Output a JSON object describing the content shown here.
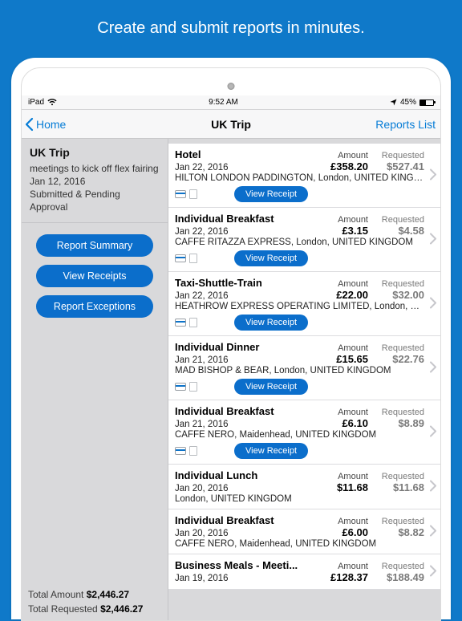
{
  "tagline": "Create and submit reports in minutes.",
  "status": {
    "device": "iPad",
    "time": "9:52 AM",
    "battery_pct": "45%"
  },
  "nav": {
    "back": "Home",
    "title": "UK Trip",
    "right": "Reports List"
  },
  "trip": {
    "name": "UK Trip",
    "desc": "meetings to kick off flex fairing",
    "date": "Jan 12, 2016",
    "status": "Submitted & Pending Approval"
  },
  "sidebar": {
    "summary_btn": "Report Summary",
    "receipts_btn": "View Receipts",
    "exceptions_btn": "Report Exceptions",
    "total_amount_label": "Total Amount",
    "total_amount": "$2,446.27",
    "total_requested_label": "Total Requested",
    "total_requested": "$2,446.27"
  },
  "labels": {
    "amount": "Amount",
    "requested": "Requested",
    "view_receipt": "View Receipt"
  },
  "expenses": [
    {
      "title": "Hotel",
      "date": "Jan 22, 2016",
      "amount": "£358.20",
      "requested": "$527.41",
      "vendor": "HILTON LONDON PADDINGTON, London, UNITED KINGD...",
      "receipt": true
    },
    {
      "title": "Individual Breakfast",
      "date": "Jan 22, 2016",
      "amount": "£3.15",
      "requested": "$4.58",
      "vendor": "CAFFE RITAZZA EXPRESS, London, UNITED KINGDOM",
      "receipt": true
    },
    {
      "title": "Taxi-Shuttle-Train",
      "date": "Jan 22, 2016",
      "amount": "£22.00",
      "requested": "$32.00",
      "vendor": "HEATHROW EXPRESS OPERATING LIMITED, London, UN...",
      "receipt": true
    },
    {
      "title": "Individual Dinner",
      "date": "Jan 21, 2016",
      "amount": "£15.65",
      "requested": "$22.76",
      "vendor": "MAD BISHOP & BEAR, London, UNITED KINGDOM",
      "receipt": true
    },
    {
      "title": "Individual Breakfast",
      "date": "Jan 21, 2016",
      "amount": "£6.10",
      "requested": "$8.89",
      "vendor": "CAFFE NERO, Maidenhead, UNITED KINGDOM",
      "receipt": true
    },
    {
      "title": "Individual Lunch",
      "date": "Jan 20, 2016",
      "amount": "$11.68",
      "requested": "$11.68",
      "vendor": "London, UNITED KINGDOM",
      "receipt": false
    },
    {
      "title": "Individual Breakfast",
      "date": "Jan 20, 2016",
      "amount": "£6.00",
      "requested": "$8.82",
      "vendor": "CAFFE NERO, Maidenhead, UNITED KINGDOM",
      "receipt": false
    },
    {
      "title": "Business Meals - Meeti...",
      "date": "Jan 19, 2016",
      "amount": "£128.37",
      "requested": "$188.49",
      "vendor": "",
      "receipt": false
    }
  ]
}
